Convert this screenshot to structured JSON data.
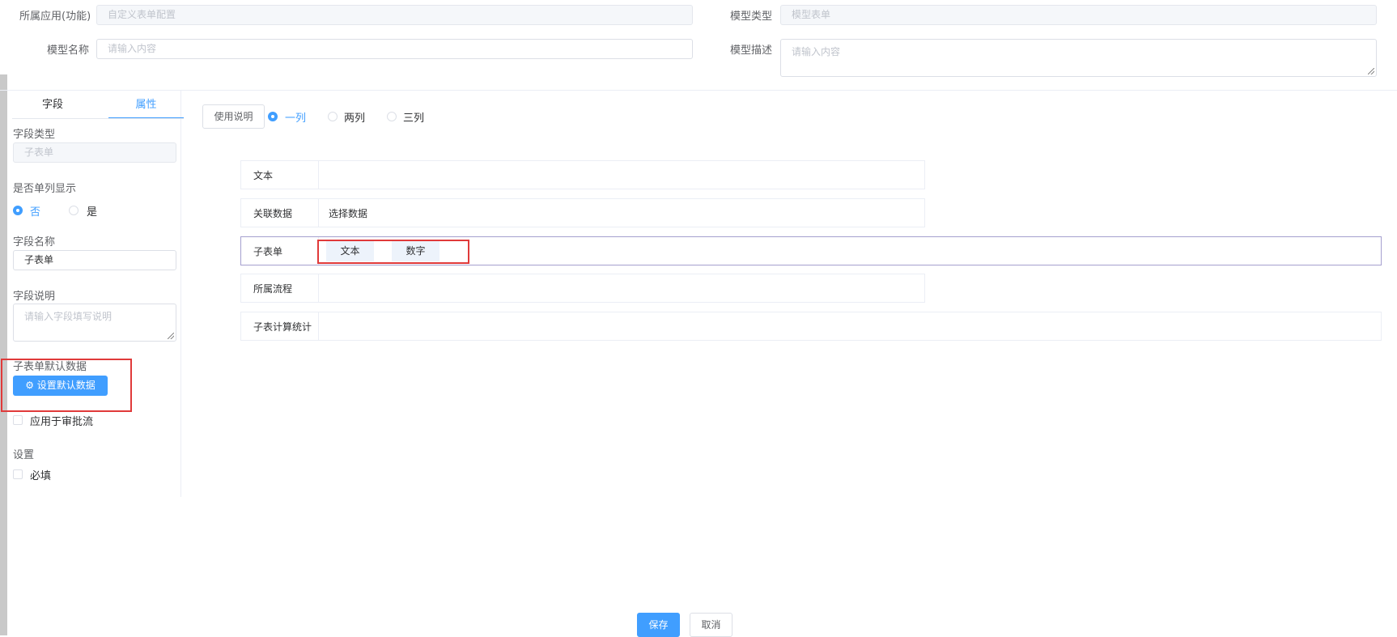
{
  "header": {
    "app_label": "所属应用(功能)",
    "app_value": "自定义表单配置",
    "model_type_label": "模型类型",
    "model_type_value": "模型表单",
    "model_name_label": "模型名称",
    "model_name_placeholder": "请输入内容",
    "model_desc_label": "模型描述",
    "model_desc_placeholder": "请输入内容"
  },
  "left_panel": {
    "tabs": [
      {
        "label": "字段",
        "active": false
      },
      {
        "label": "属性",
        "active": true
      }
    ],
    "field_type_label": "字段类型",
    "field_type_value": "子表单",
    "single_col_label": "是否单列显示",
    "single_col_options": [
      {
        "label": "否",
        "selected": true
      },
      {
        "label": "是",
        "selected": false
      }
    ],
    "field_name_label": "字段名称",
    "field_name_value": "子表单",
    "field_desc_label": "字段说明",
    "field_desc_placeholder": "请输入字段填写说明",
    "default_data_label": "子表单默认数据",
    "default_data_button": "设置默认数据",
    "approval_checkbox_label": "应用于审批流",
    "settings_label": "设置",
    "required_checkbox_label": "必填"
  },
  "canvas": {
    "usage_button": "使用说明",
    "column_options": [
      {
        "label": "一列",
        "selected": true
      },
      {
        "label": "两列",
        "selected": false
      },
      {
        "label": "三列",
        "selected": false
      }
    ],
    "rows": [
      {
        "label": "文本",
        "value": ""
      },
      {
        "label": "关联数据",
        "value": "选择数据"
      },
      {
        "label": "子表单",
        "value": "",
        "chips": [
          "文本",
          "数字"
        ]
      },
      {
        "label": "所属流程",
        "value": ""
      },
      {
        "label": "子表计算统计",
        "value": ""
      }
    ]
  },
  "footer": {
    "save_button": "保存",
    "cancel_button": "取消"
  },
  "colors": {
    "primary": "#409eff",
    "highlight_border": "#e03a3a"
  }
}
